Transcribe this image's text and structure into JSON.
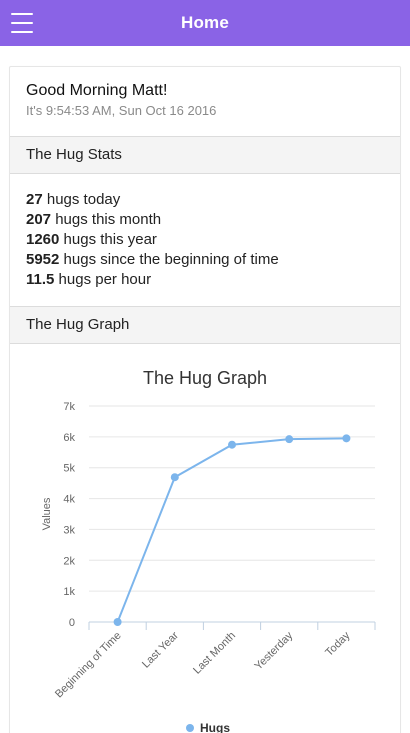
{
  "header": {
    "title": "Home",
    "bg_color": "#8a63e6",
    "menu_icon": "hamburger-menu-icon"
  },
  "greeting": {
    "title": "Good Morning Matt!",
    "time": "It's 9:54:53 AM, Sun Oct 16 2016"
  },
  "stats_section": {
    "title": "The Hug Stats",
    "rows": [
      {
        "value": "27",
        "label": "hugs today"
      },
      {
        "value": "207",
        "label": "hugs this month"
      },
      {
        "value": "1260",
        "label": "hugs this year"
      },
      {
        "value": "5952",
        "label": "hugs since the beginning of time"
      },
      {
        "value": "11.5",
        "label": "hugs per hour"
      }
    ]
  },
  "graph_section": {
    "title": "The Hug Graph"
  },
  "chart_data": {
    "type": "line",
    "title": "The Hug Graph",
    "xlabel": "",
    "ylabel": "Values",
    "categories": [
      "Beginning of Time",
      "Last Year",
      "Last Month",
      "Yesterday",
      "Today"
    ],
    "series": [
      {
        "name": "Hugs",
        "values": [
          0,
          4692,
          5745,
          5925,
          5952
        ],
        "color": "#7cb5ec"
      }
    ],
    "ylim": [
      0,
      7000
    ],
    "yticks": [
      "0",
      "1k",
      "2k",
      "3k",
      "4k",
      "5k",
      "6k",
      "7k"
    ],
    "grid": true,
    "legend": "bottom"
  }
}
